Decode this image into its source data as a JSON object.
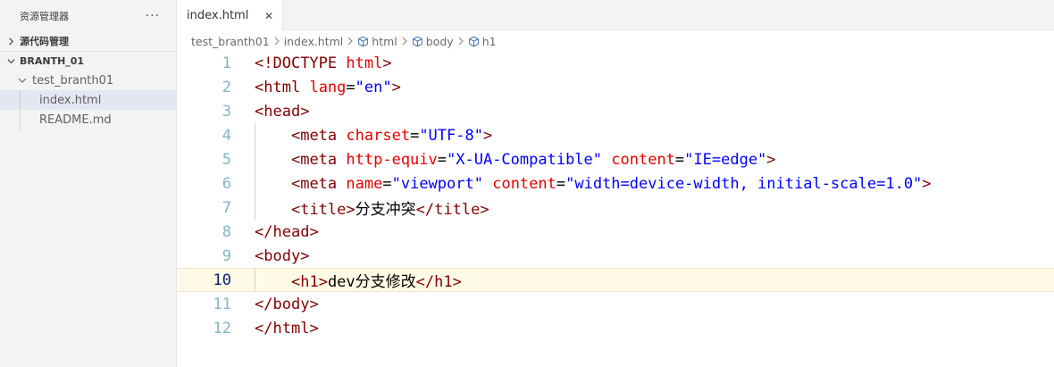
{
  "sidebar": {
    "title": "资源管理器",
    "more_label": "···",
    "sections": [
      {
        "label": "源代码管理",
        "expanded": false
      },
      {
        "label": "BRANTH_01",
        "expanded": true
      }
    ],
    "folder": {
      "label": "test_branth01",
      "expanded": true
    },
    "files": [
      {
        "label": "index.html",
        "selected": true
      },
      {
        "label": "README.md",
        "selected": false
      }
    ]
  },
  "editor": {
    "tab": {
      "label": "index.html",
      "close_label": "✕"
    },
    "breadcrumb": {
      "folder": "test_branth01",
      "file": "index.html",
      "symbols": [
        "html",
        "body",
        "h1"
      ]
    },
    "current_line": 10,
    "lines": [
      {
        "n": "1",
        "text": "<!DOCTYPE html>"
      },
      {
        "n": "2",
        "text": "<html lang=\"en\">"
      },
      {
        "n": "3",
        "text": "<head>"
      },
      {
        "n": "4",
        "text": "    <meta charset=\"UTF-8\">"
      },
      {
        "n": "5",
        "text": "    <meta http-equiv=\"X-UA-Compatible\" content=\"IE=edge\">"
      },
      {
        "n": "6",
        "text": "    <meta name=\"viewport\" content=\"width=device-width, initial-scale=1.0\">"
      },
      {
        "n": "7",
        "text": "    <title>分支冲突</title>"
      },
      {
        "n": "8",
        "text": "</head>"
      },
      {
        "n": "9",
        "text": "<body>"
      },
      {
        "n": "10",
        "text": "    <h1>dev分支修改</h1>"
      },
      {
        "n": "11",
        "text": "</body>"
      },
      {
        "n": "12",
        "text": "</html>"
      }
    ]
  },
  "colors": {
    "tag": "#800000",
    "attribute": "#e50000",
    "value": "#0000ff",
    "line_number": "#237893",
    "current_line_bg": "#fffbe6",
    "selected_file_bg": "#e4e6f1"
  }
}
